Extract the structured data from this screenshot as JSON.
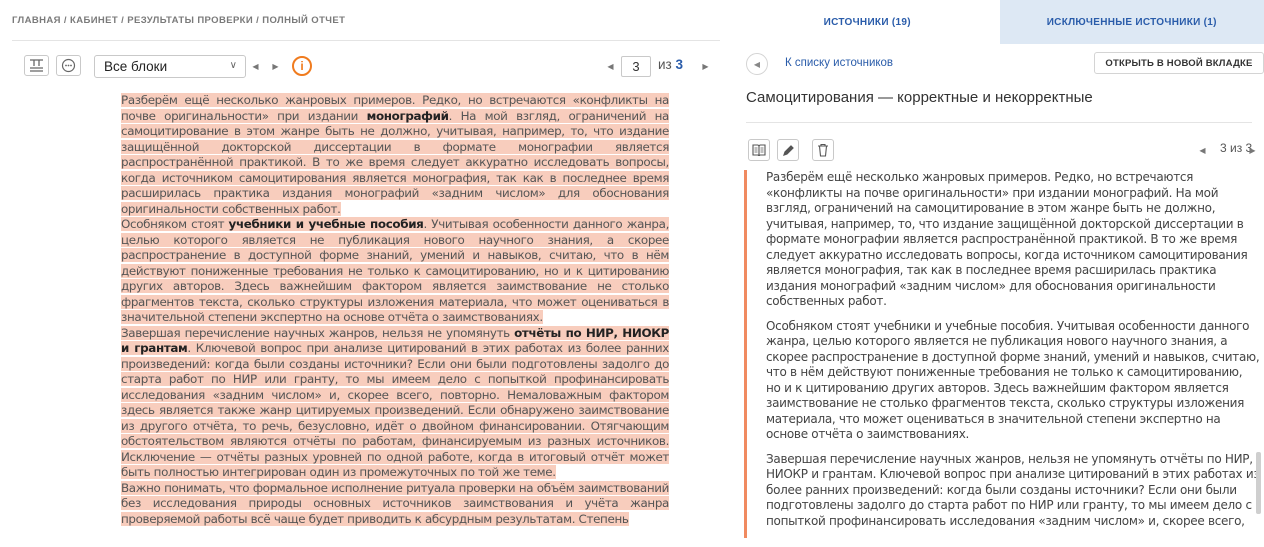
{
  "breadcrumb": "ГЛАВНАЯ / КАБИНЕТ / РЕЗУЛЬТАТЫ ПРОВЕРКИ / ПОЛНЫЙ ОТЧЕТ",
  "toolbar": {
    "block_select": "Все блоки",
    "page_current": "3",
    "page_of_prefix": "из",
    "page_total": "3"
  },
  "document": {
    "p1_a": "Разберём ещё несколько жанровых примеров. Редко, но встречаются «конфликты на почве оригинальности» при издании ",
    "p1_bold": "монографий",
    "p1_b": ". На мой взгляд, ограничений на самоцитирование в этом жанре быть не должно, учитывая, например, то, что издание защищённой докторской диссертации в формате монографии является распространённой практикой. В то же время следует аккуратно исследовать вопросы, когда источником самоцитирования является монография, так как в последнее время расширилась практика издания монографий «задним числом» для обоснования оригинальности собственных работ.",
    "p2_a": "Особняком стоят ",
    "p2_bold": "учебники и учебные пособия",
    "p2_b": ". Учитывая особенности данного жанра, целью которого является не публикация нового научного знания, а скорее распространение в доступной форме знаний, умений и навыков, считаю, что в нём действуют пониженные требования не только к самоцитированию, но и к цитированию других авторов. Здесь важнейшим фактором является заимствование не столько фрагментов текста, сколько структуры изложения материала, что может оцениваться в значительной степени экспертно на основе отчёта о заимствованиях.",
    "p3_a": "Завершая перечисление научных жанров, нельзя не упомянуть ",
    "p3_bold": "отчёты по НИР, НИОКР и грантам",
    "p3_b": ". Ключевой вопрос при анализе цитирований в этих работах из более ранних произведений: когда были созданы источники? Если они были подготовлены задолго до старта работ по НИР или гранту, то мы имеем дело с попыткой профинансировать исследования «задним числом» и, скорее всего, повторно. Немаловажным фактором здесь является также жанр цитируемых произведений. Если обнаружено заимствование из другого отчёта, то речь, безусловно, идёт о двойном финансировании. Отягчающим обстоятельством являются отчёты по работам, финансируемым из разных источников. Исключение — отчёты разных уровней по одной работе, когда в итоговый отчёт может быть полностью интегрирован один из промежуточных по той же теме.",
    "p4": "Важно понимать, что формальное исполнение ритуала проверки на объём заимствований без исследования природы основных источников заимствования и учёта жанра проверяемой работы всё чаще будет приводить к абсурдным результатам. Степень"
  },
  "right": {
    "tab_sources": "ИСТОЧНИКИ (19)",
    "tab_excluded": "ИСКЛЮЧЕННЫЕ ИСТОЧНИКИ (1)",
    "back_link": "К списку источников",
    "open_new_tab": "ОТКРЫТЬ В НОВОЙ ВКЛАДКЕ",
    "source_title": "Самоцитирования — корректные и некорректные",
    "pager": "3 из 3",
    "paragraphs": [
      "Разберём ещё несколько жанровых примеров. Редко, но встречаются «конфликты на почве оригинальности» при издании монографий. На мой взгляд, ограничений на самоцитирование в этом жанре быть не должно, учитывая, например, то, что издание защищённой докторской диссертации в формате монографии является распространённой практикой. В то же время следует аккуратно исследовать вопросы, когда источником самоцитирования является монография, так как в последнее время расширилась практика издания монографий «задним числом» для обоснования оригинальности собственных работ.",
      "Особняком стоят учебники и учебные пособия. Учитывая особенности данного жанра, целью которого является не публикация нового научного знания, а скорее распространение в доступной форме знаний, умений и навыков, считаю, что в нём действуют пониженные требования не только к самоцитированию, но и к цитированию других авторов. Здесь важнейшим фактором является заимствование не столько фрагментов текста, сколько структуры изложения материала, что может оцениваться в значительной степени экспертно на основе отчёта о заимствованиях.",
      "Завершая перечисление научных жанров, нельзя не упомянуть отчёты по НИР, НИОКР и грантам. Ключевой вопрос при анализе цитирований в этих работах из более ранних произведений: когда были созданы источники? Если они были подготовлены задолго до старта работ по НИР или гранту, то мы имеем дело с попыткой профинансировать исследования «задним числом» и, скорее всего,"
    ]
  },
  "colors": {
    "highlight": "#f8cdbd",
    "accent": "#2a5caa",
    "warning": "#f07b1e",
    "source_border": "#f08a60"
  }
}
